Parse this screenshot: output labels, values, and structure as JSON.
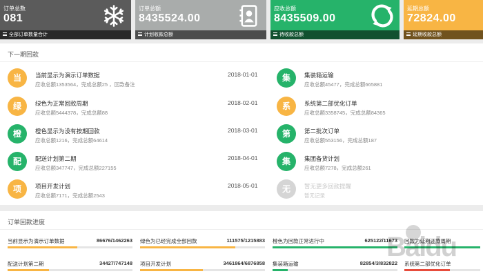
{
  "stats": [
    {
      "title": "订单总数",
      "value": "081",
      "footer": "全部订单数量合计",
      "icon": "snowflake-icon",
      "color": "#5b5b5b"
    },
    {
      "title": "订单总额",
      "value": "8435524.00",
      "footer": "计划收款总额",
      "icon": "address-book-icon",
      "color": "#a9acab"
    },
    {
      "title": "应收总额",
      "value": "8435509.00",
      "footer": "待收款总额",
      "icon": "refresh-leaf-icon",
      "color": "#26b36a"
    },
    {
      "title": "延期总额",
      "value": "72824.00",
      "footer": "延期收款总额",
      "icon": "",
      "color": "#f8b544"
    }
  ],
  "next_period": {
    "title": "下一期回款",
    "left": [
      {
        "char": "当",
        "color": "#f8b544",
        "title": "当前显示为演示订单数据",
        "sub": "应收总额1353564，完成总额25 ，回款备注",
        "date": "2018-01-01"
      },
      {
        "char": "绿",
        "color": "#f8b544",
        "title": "绿色为正常回款周期",
        "sub": "应收总额5444378，完成总额88",
        "date": "2018-02-01"
      },
      {
        "char": "橙",
        "color": "#26b36a",
        "title": "橙色显示为没有按期回款",
        "sub": "应收总额1216，完成总额64614",
        "date": "2018-03-01"
      },
      {
        "char": "配",
        "color": "#26b36a",
        "title": "配送计划第二期",
        "sub": "应收总额347747，完成总额227155",
        "date": "2018-04-01"
      },
      {
        "char": "项",
        "color": "#f8b544",
        "title": "项目开发计划",
        "sub": "应收总额7171，完成总额2543",
        "date": "2018-05-01"
      }
    ],
    "right": [
      {
        "char": "集",
        "color": "#26b36a",
        "title": "集装箱运输",
        "sub": "应收总额45477，完成总额665881"
      },
      {
        "char": "系",
        "color": "#f8b544",
        "title": "系统第二部优化订单",
        "sub": "应收总额3358745，完成总额84365"
      },
      {
        "char": "第",
        "color": "#26b36a",
        "title": "第二批次订单",
        "sub": "应收总额553156，完成总额187"
      },
      {
        "char": "集",
        "color": "#26b36a",
        "title": "集团备货计划",
        "sub": "应收总额7278，完成总额261"
      },
      {
        "char": "无",
        "color": "#d5d5d5",
        "title": "暂无更多回款提醒",
        "sub": "暂无记录",
        "muted": true
      }
    ]
  },
  "progress": {
    "title": "订单回款进度",
    "rows": [
      [
        {
          "label": "当前显示为演示订单数据",
          "value": "86676/1462263",
          "fraction": 0.56,
          "color": "#f8b544"
        },
        {
          "label": "绿色为已经完成全部回款",
          "value": "111575/1215883",
          "fraction": 0.76,
          "color": "#f8b544"
        },
        {
          "label": "橙色为回款正常进行中",
          "value": "625122/11673",
          "fraction": 1.0,
          "color": "#26b36a"
        },
        {
          "label": "回款为延期还款周期",
          "value": "",
          "fraction": 1.0,
          "color": "#26b36a"
        }
      ],
      [
        {
          "label": "配送计划第二期",
          "value": "34427/747148",
          "fraction": 0.33,
          "color": "#f8b544"
        },
        {
          "label": "项目开发计划",
          "value": "3461864/6876858",
          "fraction": 0.5,
          "color": "#f8b544"
        },
        {
          "label": "集装箱运输",
          "value": "82854/3/832822",
          "fraction": 0.12,
          "color": "#26b36a"
        },
        {
          "label": "系统第二部优化订单",
          "value": "",
          "fraction": 0.6,
          "color": "#e74c3c"
        }
      ]
    ]
  },
  "watermark": "Baidu"
}
